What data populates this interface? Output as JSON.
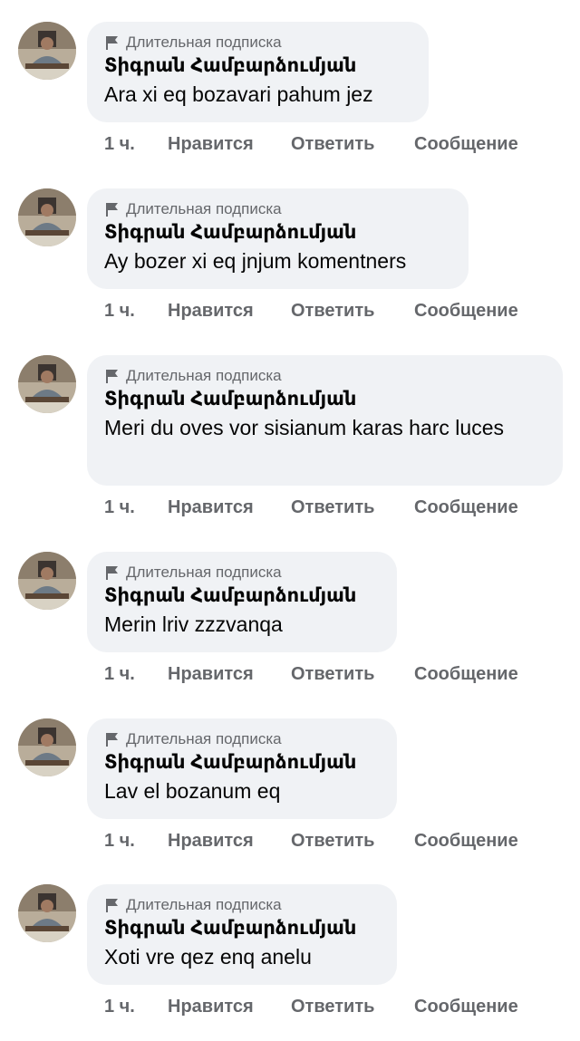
{
  "comments": [
    {
      "badge": "Длительная подписка",
      "author": "Տիգրան Համբարձումյան",
      "text": "Ara xi eq bozavari pahum jez",
      "time": "1 ч.",
      "like": "Нравится",
      "reply": "Ответить",
      "message": "Сообщение"
    },
    {
      "badge": "Длительная подписка",
      "author": "Տիգրան Համբարձումյան",
      "text": "Ay bozer xi eq jnjum komentners",
      "time": "1 ч.",
      "like": "Нравится",
      "reply": "Ответить",
      "message": "Сообщение"
    },
    {
      "badge": "Длительная подписка",
      "author": "Տիգրան Համբարձումյան",
      "text": "Meri du oves vor sisianum karas harc luces",
      "time": "1 ч.",
      "like": "Нравится",
      "reply": "Ответить",
      "message": "Сообщение"
    },
    {
      "badge": "Длительная подписка",
      "author": "Տիգրան Համբարձումյան",
      "text": "Merin lriv zzzvanqa",
      "time": "1 ч.",
      "like": "Нравится",
      "reply": "Ответить",
      "message": "Сообщение"
    },
    {
      "badge": "Длительная подписка",
      "author": "Տիգրան Համբարձումյան",
      "text": "Lav el bozanum eq",
      "time": "1 ч.",
      "like": "Нравится",
      "reply": "Ответить",
      "message": "Сообщение"
    },
    {
      "badge": "Длительная подписка",
      "author": "Տիգրան Համբարձումյան",
      "text": "Xoti vre qez enq anelu",
      "time": "1 ч.",
      "like": "Нравится",
      "reply": "Ответить",
      "message": "Сообщение"
    }
  ],
  "icons": {
    "badge_icon": "flag-icon",
    "avatar": "profile-photo"
  },
  "colors": {
    "bubble": "#f0f2f5",
    "secondary_text": "#65676b",
    "primary_text": "#050505"
  }
}
